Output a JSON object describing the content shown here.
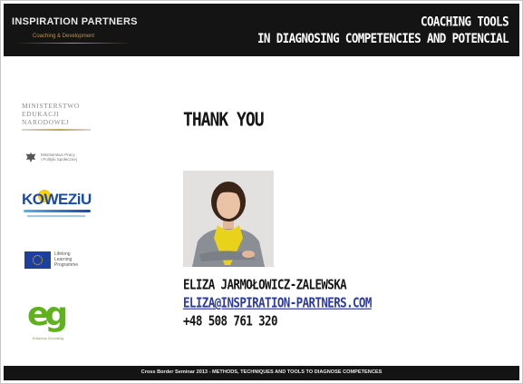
{
  "header": {
    "brand": "INSPIRATION PARTNERS",
    "brand_sub": "Coaching & Development",
    "title_line1": "COACHING TOOLS",
    "title_line2": "IN DIAGNOSING COMPETENCIES AND POTENCIAL"
  },
  "logos": {
    "ministry": {
      "line1": "MINISTERSTWO",
      "line2": "EDUKACJI",
      "line3": "NARODOWEJ"
    },
    "ministry_labour": {
      "line1": "Ministerstwo Pracy",
      "line2": "i Polityki Społecznej",
      "icon": "eagle-emblem-icon"
    },
    "koweziu": {
      "name": "KOWEZiU"
    },
    "eu_programme": {
      "line1": "Lifelong",
      "line2": "Learning",
      "line3": "Programme",
      "icon": "eu-flag-icon"
    },
    "eg": {
      "mark": "eg",
      "sub": "Erasmus Grundtvig"
    }
  },
  "main": {
    "heading": "THANK YOU",
    "contact": {
      "name": "ELIZA JARMOŁOWICZ-ZALEWSKA",
      "email": "ELIZA@INSPIRATION-PARTNERS.COM",
      "phone": "+48 508 761 320"
    }
  },
  "footer": {
    "text": "Cross Border Seminar 2013 - METHODS, TECHNIQUES AND TOOLS TO DIAGNOSE COMPETENCES"
  },
  "colors": {
    "header_bg": "#141414",
    "accent_gold": "#b8934a",
    "email_link": "#2d3a9e",
    "koweziu_blue": "#1a4aa8",
    "eg_green": "#5fb11d"
  }
}
